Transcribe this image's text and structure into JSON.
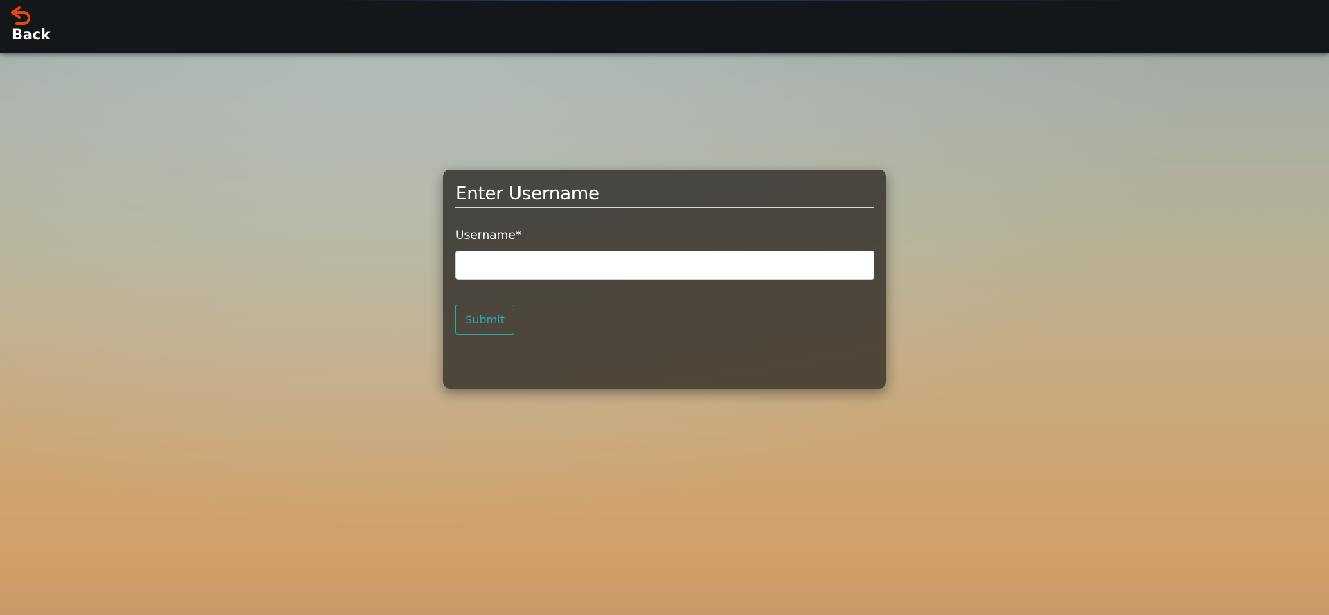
{
  "header": {
    "back_label": "Back",
    "back_icon": "back-arrow-icon",
    "back_icon_color": "#e8460f",
    "background_color": "#141719"
  },
  "form": {
    "title": "Enter Username",
    "username_label": "Username*",
    "username_value": "",
    "username_placeholder": "",
    "submit_label": "Submit",
    "accent_color": "#2aa8b3"
  }
}
